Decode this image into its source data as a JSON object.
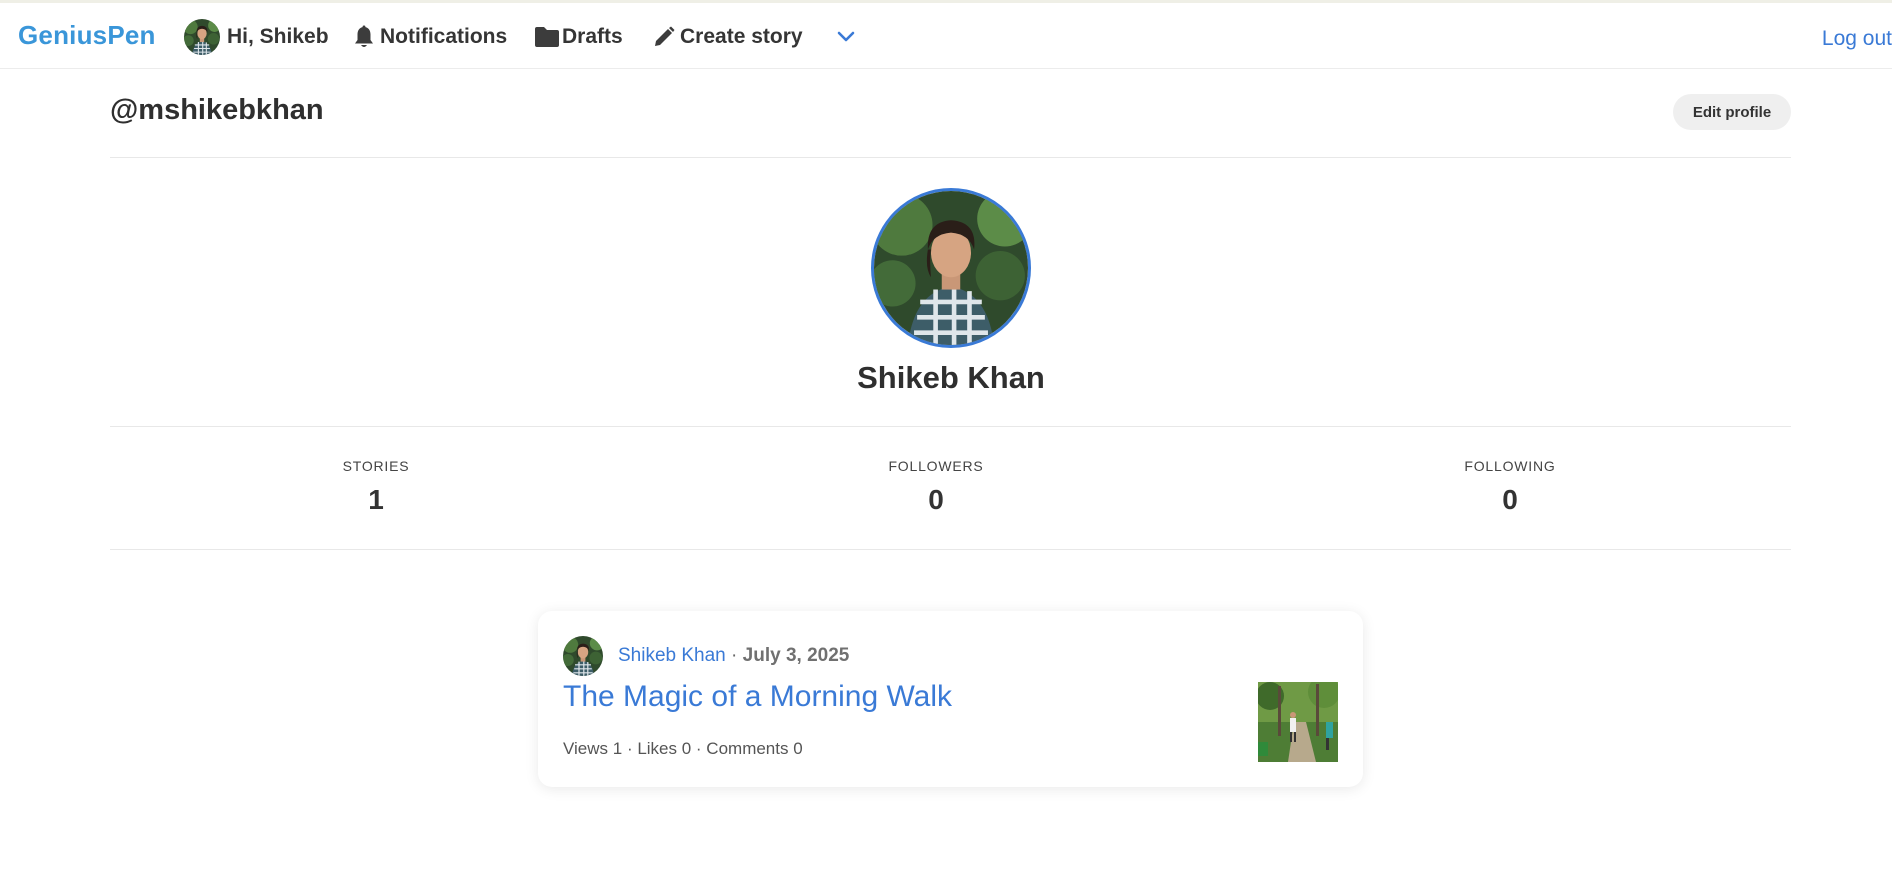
{
  "nav": {
    "logo": "GeniusPen",
    "greeting": "Hi, Shikeb",
    "notifications": "Notifications",
    "drafts": "Drafts",
    "create_story": "Create story",
    "logout": "Log out",
    "icons": [
      "avatar",
      "bell-icon",
      "folder-icon",
      "pencil-icon",
      "chevron-down-icon"
    ],
    "accent_color": "#3a96d9"
  },
  "profile": {
    "handle": "@mshikebkhan",
    "edit_label": "Edit profile",
    "name": "Shikeb Khan",
    "avatar_border_color": "#3a7ad6"
  },
  "stats": [
    {
      "label": "STORIES",
      "value": "1"
    },
    {
      "label": "FOLLOWERS",
      "value": "0"
    },
    {
      "label": "FOLLOWING",
      "value": "0"
    }
  ],
  "story": {
    "author": "Shikeb Khan",
    "separator": " · ",
    "date": "July 3, 2025",
    "title": "The Magic of a Morning Walk",
    "stats_line": "Views 1 · Likes 0 · Comments 0",
    "link_color": "#3a7ad6"
  }
}
